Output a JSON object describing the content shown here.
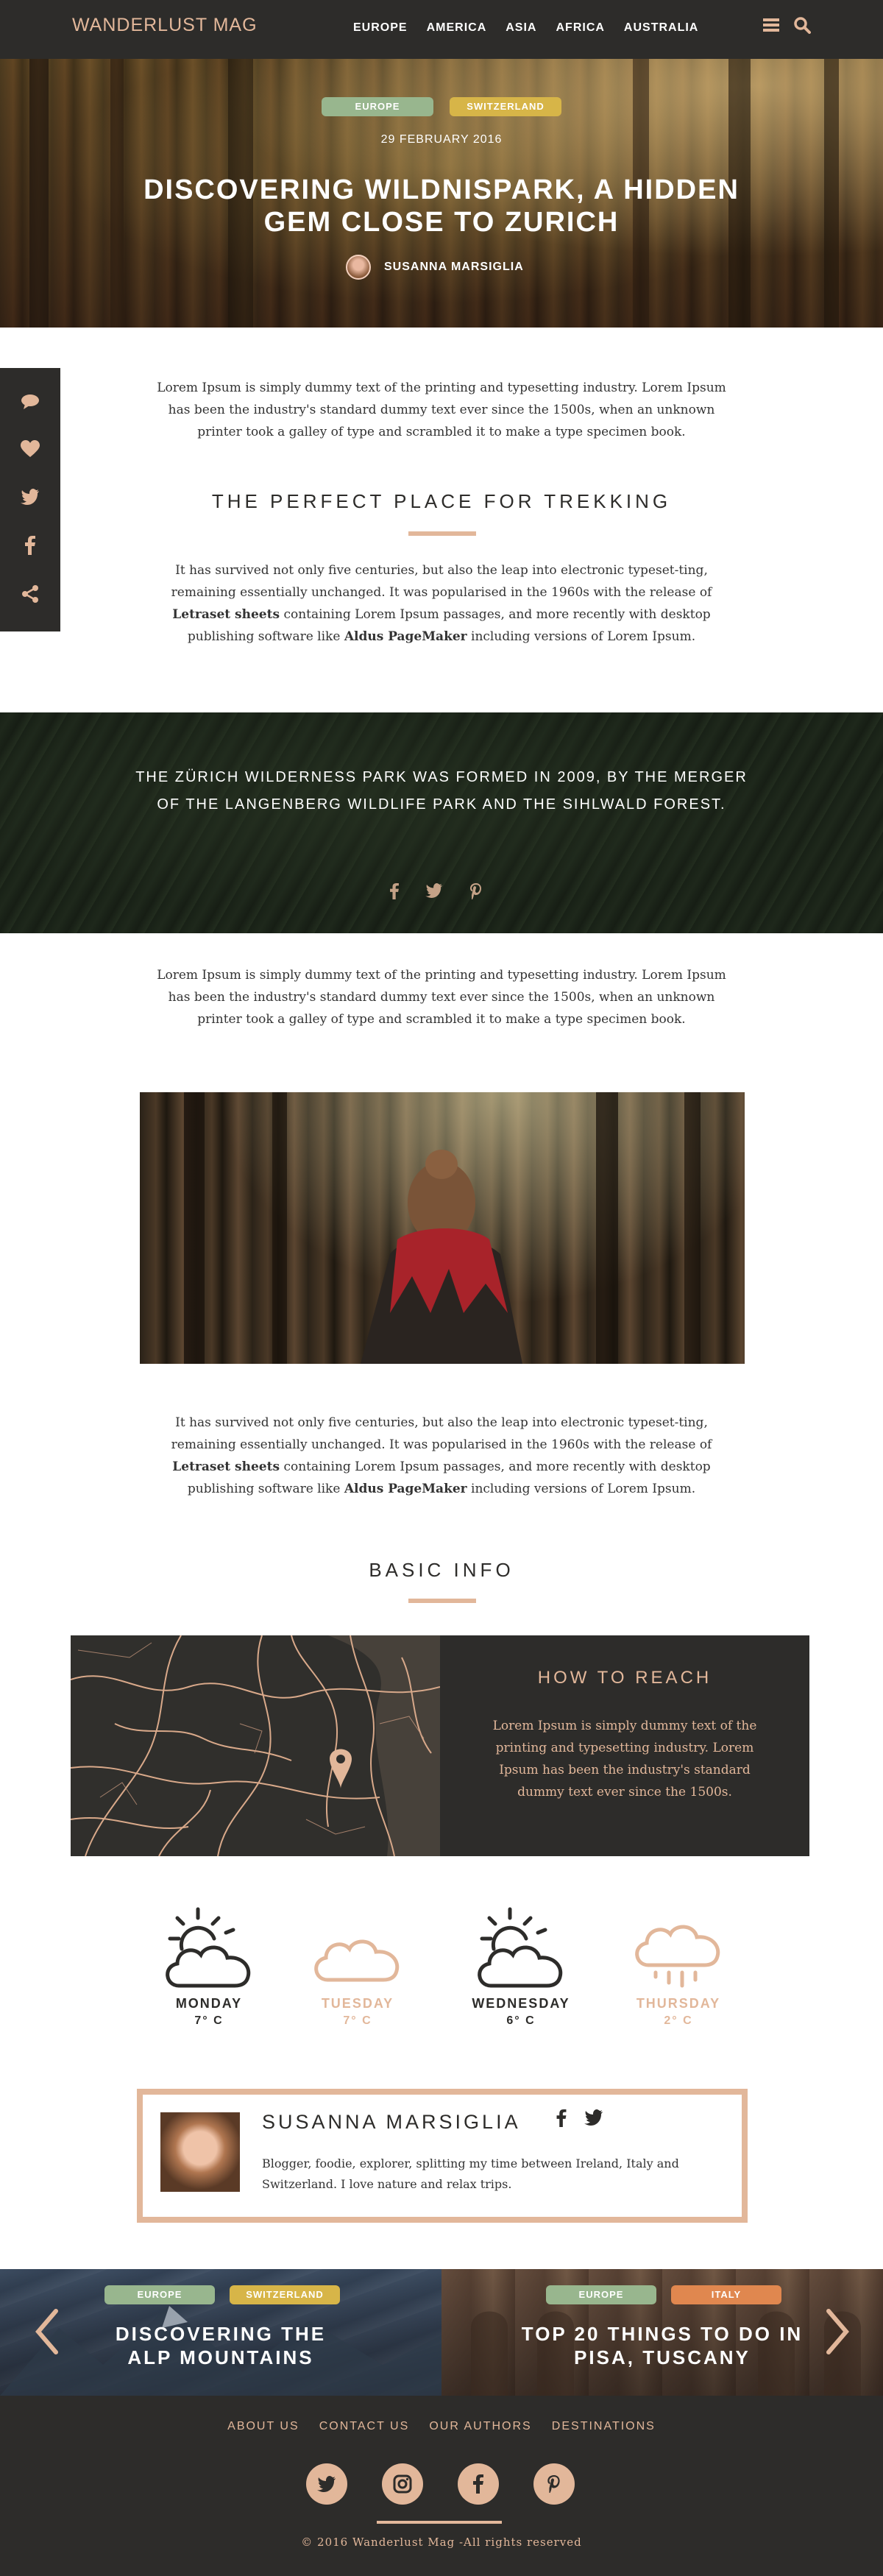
{
  "header": {
    "logo_part1": "WANDERLUST",
    "logo_part2": "MAG",
    "nav": [
      "EUROPE",
      "AMERICA",
      "ASIA",
      "AFRICA",
      "AUSTRALIA"
    ],
    "icons": [
      "menu-icon",
      "search-icon"
    ]
  },
  "hero": {
    "tags": [
      "EUROPE",
      "SWITZERLAND"
    ],
    "date": "29 FEBRUARY 2016",
    "title": "DISCOVERING WILDNISPARK, A HIDDEN GEM CLOSE TO ZURICH",
    "author": "SUSANNA MARSIGLIA"
  },
  "share_bar": [
    "comment-icon",
    "heart-icon",
    "twitter-icon",
    "facebook-icon",
    "share-icon"
  ],
  "intro": "Lorem Ipsum is simply dummy text of the printing and typesetting industry. Lorem Ipsum has been the industry's standard dummy text ever since the 1500s, when an unknown printer took a galley of type and scrambled it to make a type specimen book.",
  "section1": {
    "title": "THE PERFECT PLACE FOR TREKKING",
    "text_before": "It has survived not only five centuries, but also the leap into electronic typeset-ting, remaining essentially unchanged. It was popularised in the 1960s with the release of ",
    "bold1": "Letraset sheets",
    "text_mid": " containing Lorem Ipsum passages, and more recently with desktop publishing software like ",
    "bold2": "Aldus PageMaker",
    "text_after": " including versions of Lorem Ipsum."
  },
  "quote": {
    "text": "THE ZÜRICH WILDERNESS PARK WAS FORMED IN 2009, BY THE MERGER OF THE LANGENBERG WILDLIFE PARK AND THE SIHLWALD FOREST.",
    "icons": [
      "facebook-icon",
      "twitter-icon",
      "pinterest-icon"
    ]
  },
  "intro2": "Lorem Ipsum is simply dummy text of the printing and typesetting industry. Lorem Ipsum has been the industry's standard dummy text ever since the 1500s, when an unknown printer took a galley of type and scrambled it to make a type specimen book.",
  "section2": {
    "text_before": "It has survived not only five centuries, but also the leap into electronic typeset-ting, remaining essentially unchanged. It was popularised in the 1960s with the release of ",
    "bold1": "Letraset sheets",
    "text_mid": " containing Lorem Ipsum passages, and more recently with desktop publishing software like ",
    "bold2": "Aldus PageMaker",
    "text_after": " including versions of Lorem Ipsum."
  },
  "basic_info": {
    "title": "BASIC INFO",
    "reach_title": "HOW TO REACH",
    "reach_text": "Lorem Ipsum is simply dummy text of the printing and typesetting industry. Lorem Ipsum has been the industry's standard dummy text ever since the 1500s."
  },
  "weather": [
    {
      "day": "MONDAY",
      "temp": "7° C",
      "icon": "sun-cloud-icon",
      "style": "dark"
    },
    {
      "day": "TUESDAY",
      "temp": "7° C",
      "icon": "cloud-icon",
      "style": "light"
    },
    {
      "day": "WEDNESDAY",
      "temp": "6° C",
      "icon": "sun-cloud-icon",
      "style": "dark"
    },
    {
      "day": "THURSDAY",
      "temp": "2° C",
      "icon": "rain-cloud-icon",
      "style": "light"
    }
  ],
  "author_box": {
    "name": "SUSANNA MARSIGLIA",
    "bio": "Blogger, foodie, explorer, splitting my time between Ireland, Italy and Switzerland. I love nature and relax trips.",
    "social": [
      "facebook-icon",
      "twitter-icon"
    ]
  },
  "related": [
    {
      "tags": [
        "EUROPE",
        "SWITZERLAND"
      ],
      "title": "DISCOVERING THE ALP MOUNTAINS"
    },
    {
      "tags": [
        "EUROPE",
        "ITALY"
      ],
      "title": "TOP 20 THINGS TO DO IN PISA, TUSCANY"
    }
  ],
  "footer": {
    "links": [
      "ABOUT US",
      "CONTACT US",
      "OUR AUTHORS",
      "DESTINATIONS"
    ],
    "social": [
      "twitter-icon",
      "instagram-icon",
      "facebook-icon",
      "pinterest-icon"
    ],
    "copyright": "© 2016 Wanderlust Mag -All rights reserved"
  },
  "colors": {
    "dark": "#2d2c2a",
    "accent": "#e2b79a",
    "tag_green": "#98b68e",
    "tag_yellow": "#d7b548",
    "tag_orange": "#e0874f"
  }
}
